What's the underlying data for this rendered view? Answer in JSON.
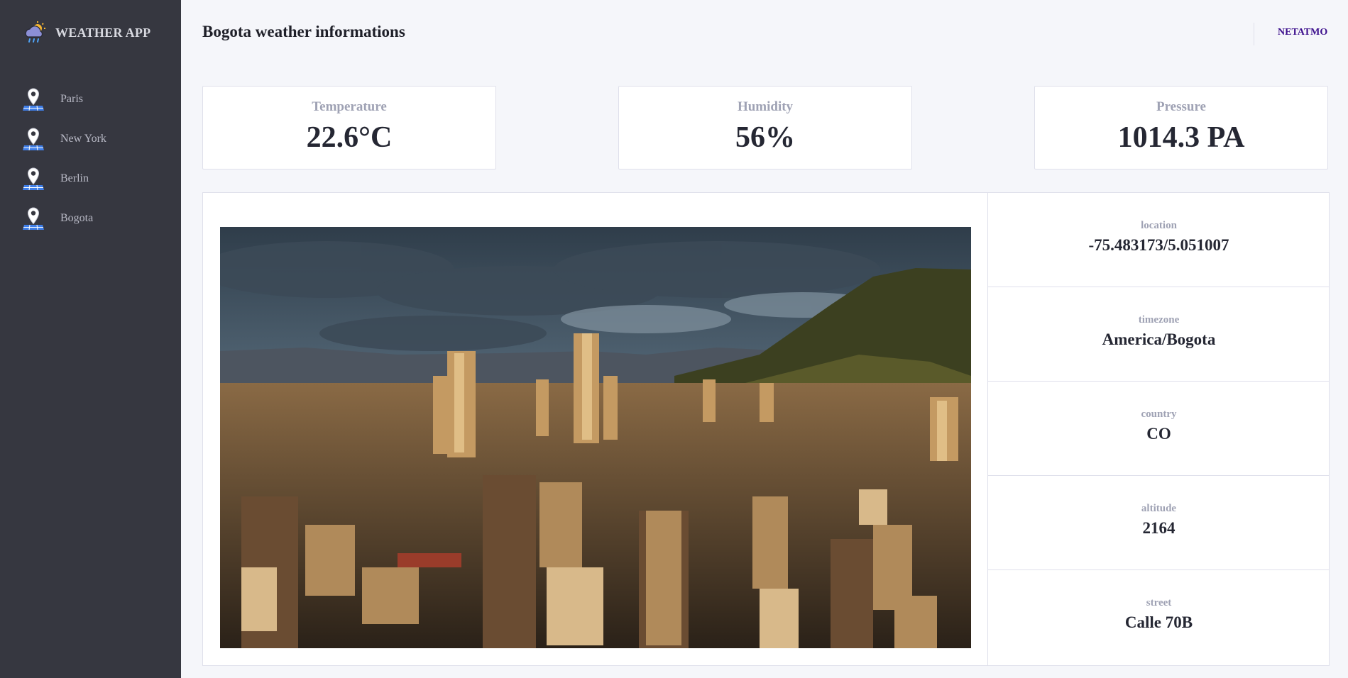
{
  "app": {
    "name": "WEATHER APP",
    "logo_icon": "cloud-sun-rain-icon"
  },
  "sidebar": {
    "items": [
      {
        "label": "Paris",
        "icon": "map-pin-icon"
      },
      {
        "label": "New York",
        "icon": "map-pin-icon"
      },
      {
        "label": "Berlin",
        "icon": "map-pin-icon"
      },
      {
        "label": "Bogota",
        "icon": "map-pin-icon"
      }
    ]
  },
  "header": {
    "title": "Bogota weather informations",
    "link_label": "NETATMO"
  },
  "stats": {
    "temperature": {
      "label": "Temperature",
      "value": "22.6°C"
    },
    "humidity": {
      "label": "Humidity",
      "value": "56%"
    },
    "pressure": {
      "label": "Pressure",
      "value": "1014.3 PA"
    }
  },
  "photo": {
    "subject": "Bogota city skyline photo"
  },
  "details": [
    {
      "label": "location",
      "value": "-75.483173/5.051007"
    },
    {
      "label": "timezone",
      "value": "America/Bogota"
    },
    {
      "label": "country",
      "value": "CO"
    },
    {
      "label": "altitude",
      "value": "2164"
    },
    {
      "label": "street",
      "value": "Calle 70B"
    }
  ],
  "colors": {
    "sidebar_bg": "#363740",
    "page_bg": "#f5f6fa",
    "link": "#3b0e8c",
    "pin_blue": "#3f7ee8"
  }
}
